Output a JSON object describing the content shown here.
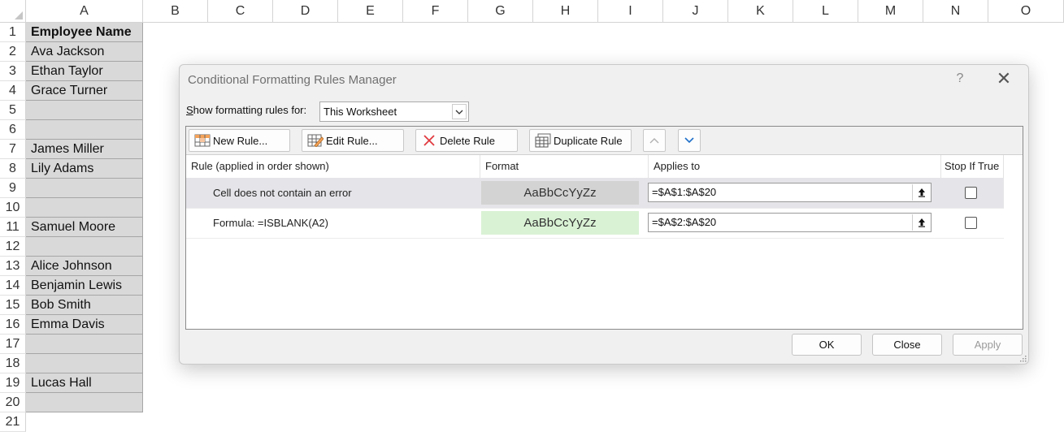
{
  "sheet": {
    "columns": [
      "A",
      "B",
      "C",
      "D",
      "E",
      "F",
      "G",
      "H",
      "I",
      "J",
      "K",
      "L",
      "M",
      "N",
      "O"
    ],
    "rows": [
      "1",
      "2",
      "3",
      "4",
      "5",
      "6",
      "7",
      "8",
      "9",
      "10",
      "11",
      "12",
      "13",
      "14",
      "15",
      "16",
      "17",
      "18",
      "19",
      "20",
      "21"
    ],
    "column_a": [
      "Employee Name",
      "Ava Jackson",
      "Ethan Taylor",
      "Grace Turner",
      "",
      "",
      "James Miller",
      "Lily Adams",
      "",
      "",
      "Samuel Moore",
      "",
      "Alice Johnson",
      "Benjamin Lewis",
      "Bob Smith",
      "Emma Davis",
      "",
      "",
      "Lucas Hall",
      ""
    ],
    "cell_fill": "#d9d9d9"
  },
  "dialog": {
    "title": "Conditional Formatting Rules Manager",
    "help": "?",
    "close_glyph": "✕",
    "show_label_prefix": "S",
    "show_label_rest": "how formatting rules for:",
    "show_value": "This Worksheet",
    "toolbar": {
      "new_rule": "New Rule...",
      "edit_rule": "Edit Rule...",
      "delete_rule": "Delete Rule",
      "duplicate_rule": "Duplicate Rule"
    },
    "columns": {
      "rule": "Rule (applied in order shown)",
      "format": "Format",
      "applies_to": "Applies to",
      "stop_if_true": "Stop If True"
    },
    "rules": [
      {
        "description": "Cell does not contain an error",
        "preview": "AaBbCcYyZz",
        "preview_bg": "#d3d3d3",
        "applies_to": "=$A$1:$A$20",
        "stop_if_true": false
      },
      {
        "description": "Formula: =ISBLANK(A2)",
        "preview": "AaBbCcYyZz",
        "preview_bg": "#d9f2d4",
        "applies_to": "=$A$2:$A$20",
        "stop_if_true": false
      }
    ],
    "buttons": {
      "ok": "OK",
      "close": "Close",
      "apply": "Apply"
    }
  }
}
